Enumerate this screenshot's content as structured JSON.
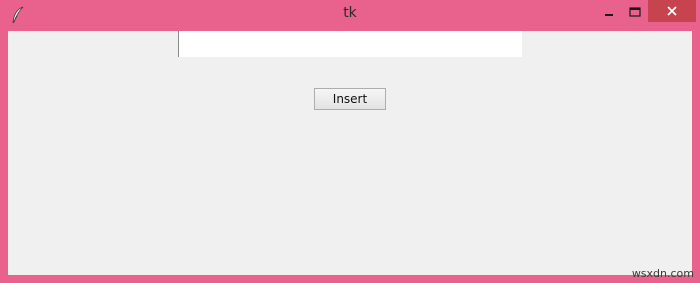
{
  "window": {
    "title": "tk",
    "app_icon": "tk-feather-icon",
    "frame_color": "#e8628d",
    "close_hover_color": "#c7444f"
  },
  "controls": {
    "minimize_icon": "minimize-icon",
    "maximize_icon": "maximize-icon",
    "close_icon": "close-icon"
  },
  "entry": {
    "value": "",
    "placeholder": ""
  },
  "insert_button": {
    "label": "Insert"
  },
  "watermark": {
    "text": "wsxdn.com"
  }
}
